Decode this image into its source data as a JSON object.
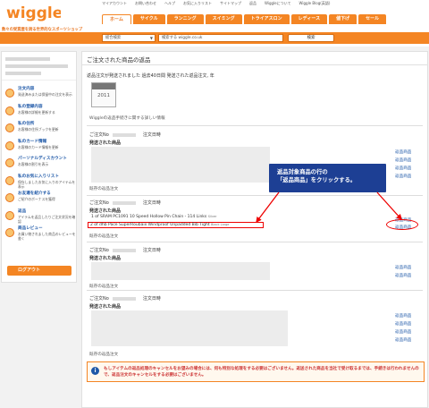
{
  "brand": {
    "logo_text": "wiggle",
    "tagline": "数々の受賞歴を誇る世界的なスポーツショップ"
  },
  "top_links": [
    "マイアカウント",
    "お問い合わせ",
    "ヘルプ",
    "お気に入りリスト",
    "サイトマップ",
    "返品",
    "Wiggleについて",
    "Wiggle Blog(英語)"
  ],
  "nav_tabs": [
    "ホーム",
    "サイクル",
    "ランニング",
    "スイミング",
    "トライアスロン",
    "レディース",
    "値下げ",
    "セール"
  ],
  "search": {
    "category": "総合検索",
    "query": "検索する wiggle.co.uk",
    "button": "検索"
  },
  "sidebar": {
    "items": [
      {
        "title": "注文内容",
        "desc": "発送済みまたは保留中の注文を表示"
      },
      {
        "title": "私の登録内容",
        "desc": "お客様の詳細を更新する"
      },
      {
        "title": "私の住所",
        "desc": "お客様の住所ブックを更新"
      },
      {
        "title": "私のカード情報",
        "desc": "お客様のカード情報を更新"
      },
      {
        "title": "パーソナルディスカウント",
        "desc": "お客様の割引を表示"
      },
      {
        "title": "私のお気に入りリスト",
        "desc": "保存しましたお気に入りのアイテムを表示"
      },
      {
        "title": "お友達を紹介する",
        "desc": "ご紹介のボーナスを獲得"
      },
      {
        "title": "返品",
        "desc": "アイテムを返品したりご注文状況を確認"
      },
      {
        "title": "商品レビュー",
        "desc": "お買い物されました商品のレビューを書く"
      }
    ],
    "logout": "ログアウト"
  },
  "main": {
    "title": "ご注文された商品の返品",
    "intro": "返品注文が発送されました 過去40日間 発送された返品注文, 年",
    "calendar_year": "2011",
    "policy_link": "Wiggleの返品手続きに関する詳しい情報",
    "order_no_label": "ご注文No",
    "order_date_label": "注文日時",
    "returned_items_label": "発送された商品",
    "history_label": "既存の返品注文",
    "return_link": "返品商品",
    "item1": {
      "text": "1 of SRAM PC1091 10 Speed Hollow Pin Chain - 114 Links",
      "variant": "Silver"
    },
    "item2": {
      "text": "2 of dhb Pace SuperRoubaix Windproof Unpadded Bib Tight",
      "variant": "Black Large"
    },
    "callout_line1": "返品対象商品の行の",
    "callout_line2": "「返品商品」をクリックする。",
    "info": "もしアイテムの返品処理のキャンセルをお望みの場合には、何も特別な処理をする必要はございません。返送された商品を当社で受け取るまでは、手続きは行われませんので、返品注文のキャンセルをする必要はございません。"
  },
  "colors": {
    "brand_orange": "#f48523",
    "link_blue": "#1e58a8",
    "callout_navy": "#1d3f94",
    "highlight_red": "#e00000"
  }
}
